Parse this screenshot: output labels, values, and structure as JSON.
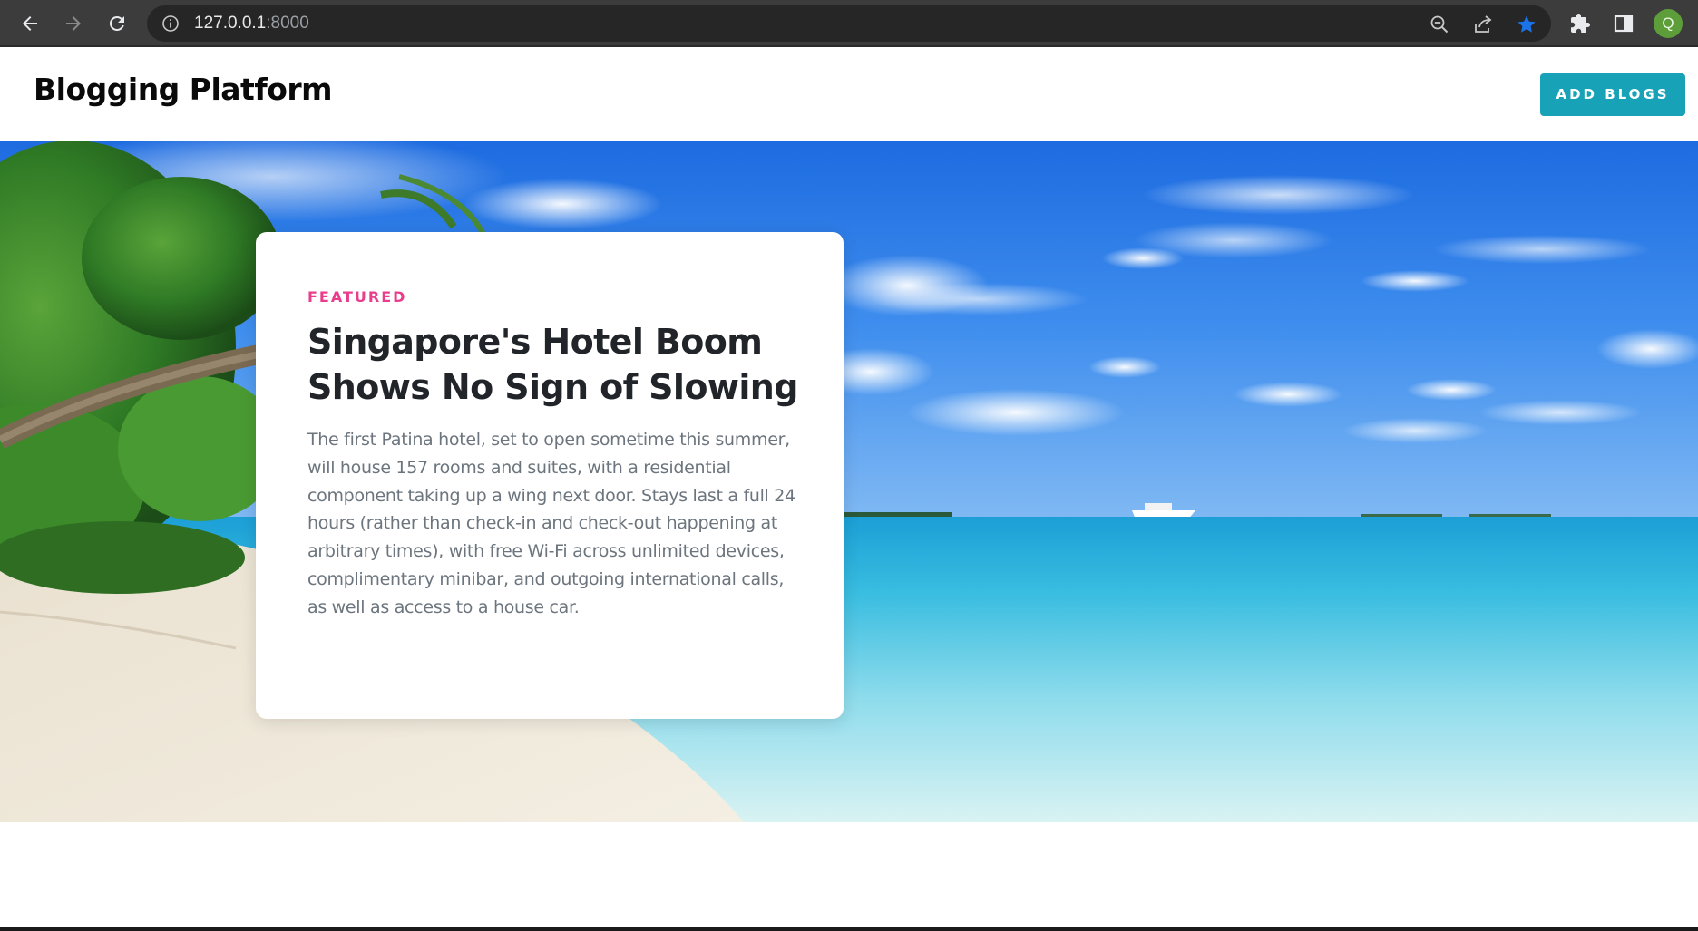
{
  "browser": {
    "url_host": "127.0.0.1",
    "url_port": ":8000",
    "profile_initial": "Q",
    "icons": {
      "back": "arrow-left-icon",
      "forward": "arrow-right-icon",
      "reload": "reload-icon",
      "site_info": "info-icon",
      "zoom": "zoom-out-icon",
      "share": "share-icon",
      "bookmark": "star-icon",
      "extensions": "puzzle-icon",
      "side_panel": "side-panel-icon"
    },
    "colors": {
      "bookmark_star": "#1a73e8",
      "avatar": "#5e9e3a"
    }
  },
  "header": {
    "site_title": "Blogging Platform",
    "add_button_label": "ADD BLOGS",
    "add_button_color": "#17a2b8"
  },
  "hero": {
    "background": "tropical-beach-photo",
    "card": {
      "label": "FEATURED",
      "label_color": "#e83e8c",
      "title": "Singapore's Hotel Boom Shows No Sign of Slowing",
      "excerpt": "The first Patina hotel, set to open sometime this summer, will house 157 rooms and suites, with a residential component taking up a wing next door. Stays last a full 24 hours (rather than check-in and check-out happening at arbitrary times), with free Wi-Fi across unlimited devices, complimentary minibar, and outgoing international calls, as well as access to a house car."
    }
  }
}
